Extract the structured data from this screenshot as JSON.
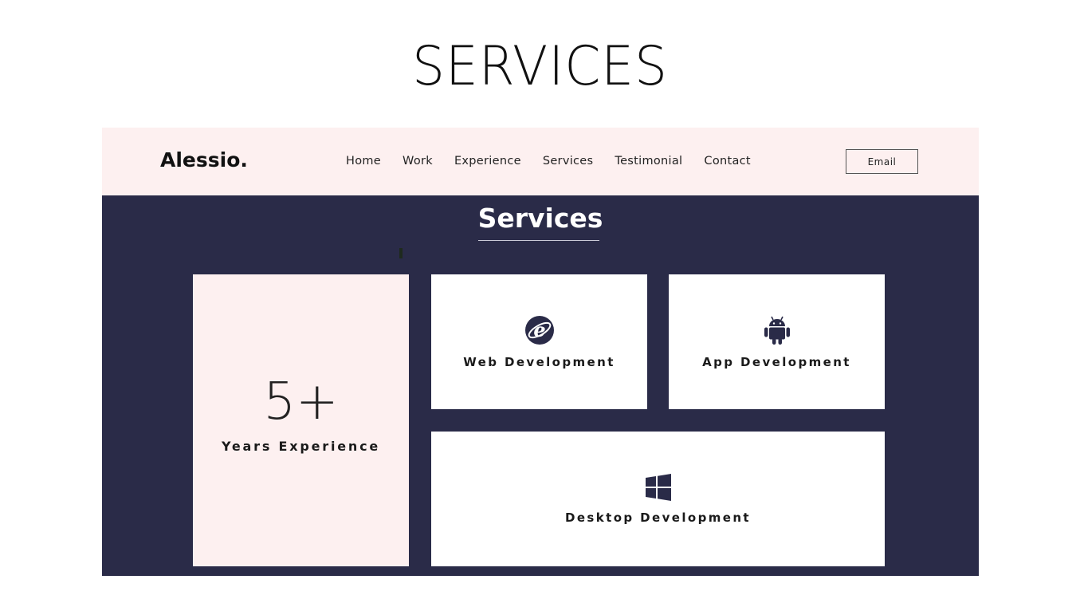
{
  "slide": {
    "title": "SERVICES"
  },
  "navbar": {
    "brand": "Alessio.",
    "links": [
      "Home",
      "Work",
      "Experience",
      "Services",
      "Testimonial",
      "Contact"
    ],
    "email_button": "Email"
  },
  "section": {
    "title": "Services"
  },
  "cards": {
    "experience": {
      "number": "5+",
      "label": "Years Experience"
    },
    "web": {
      "label": "Web Development",
      "icon": "internet-explorer-icon"
    },
    "app": {
      "label": "App Development",
      "icon": "android-icon"
    },
    "desktop": {
      "label": "Desktop Development",
      "icon": "windows-icon"
    }
  },
  "colors": {
    "navbar_bg": "#fdf0f0",
    "section_bg": "#2a2b48",
    "card_bg": "#ffffff",
    "icon_color": "#2a2b48"
  }
}
